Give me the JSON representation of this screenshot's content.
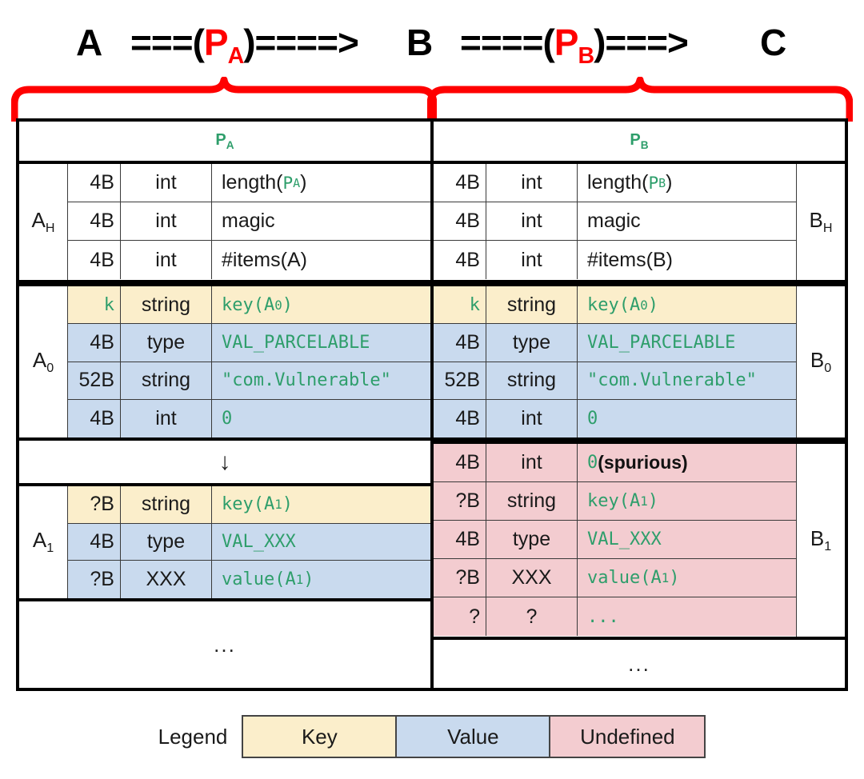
{
  "flow": {
    "node_a": "A",
    "arrow_a_pre": "===(",
    "arrow_a_label": "P",
    "arrow_a_sub": "A",
    "arrow_a_post": ")====>",
    "node_b": "B",
    "arrow_b_pre": "====(",
    "arrow_b_label": "P",
    "arrow_b_sub": "B",
    "arrow_b_post": ")===>",
    "node_c": "C",
    "accent_color": "#ff0000"
  },
  "sections": {
    "a": {
      "title_label": "P",
      "title_sub": "A",
      "blocks": [
        {
          "label": "A",
          "label_sub": "H",
          "tint": "none",
          "rows": [
            {
              "size": "4B",
              "type": "int",
              "value": "length(P",
              "value_sub": "A",
              "value_tail": ")",
              "value_mono_part": true
            },
            {
              "size": "4B",
              "type": "int",
              "value": "magic"
            },
            {
              "size": "4B",
              "type": "int",
              "value": "#items(A)"
            }
          ]
        },
        {
          "label": "A",
          "label_sub": "0",
          "rows": [
            {
              "size": "k",
              "size_mono": true,
              "type": "string",
              "value": "key(A",
              "value_sub": "0",
              "value_tail": ")",
              "tint": "key"
            },
            {
              "size": "4B",
              "type": "type",
              "value": "VAL_PARCELABLE",
              "tint": "value"
            },
            {
              "size": "52B",
              "type": "string",
              "value": "\"com.Vulnerable\"",
              "tint": "value"
            },
            {
              "size": "4B",
              "type": "int",
              "value": "0",
              "tint": "value"
            }
          ]
        },
        {
          "label": "A",
          "label_sub": "1",
          "rows": [
            {
              "size": "?B",
              "type": "string",
              "value": "key(A",
              "value_sub": "1",
              "value_tail": ")",
              "tint": "key"
            },
            {
              "size": "4B",
              "type": "type",
              "value": "VAL_XXX",
              "tint": "value"
            },
            {
              "size": "?B",
              "type": "XXX",
              "value": "value(A",
              "value_sub": "1",
              "value_tail": ")",
              "tint": "value"
            }
          ]
        }
      ],
      "gap_arrow": "↓",
      "tail_dots": "..."
    },
    "b": {
      "title_label": "P",
      "title_sub": "B",
      "blocks": [
        {
          "label": "B",
          "label_sub": "H",
          "tint": "none",
          "rows": [
            {
              "size": "4B",
              "type": "int",
              "value": "length(P",
              "value_sub": "B",
              "value_tail": ")"
            },
            {
              "size": "4B",
              "type": "int",
              "value": "magic"
            },
            {
              "size": "4B",
              "type": "int",
              "value": "#items(B)"
            }
          ]
        },
        {
          "label": "B",
          "label_sub": "0",
          "rows": [
            {
              "size": "k",
              "size_mono": true,
              "type": "string",
              "value": "key(A",
              "value_sub": "0",
              "value_tail": ")",
              "tint": "key"
            },
            {
              "size": "4B",
              "type": "type",
              "value": "VAL_PARCELABLE",
              "tint": "value"
            },
            {
              "size": "52B",
              "type": "string",
              "value": "\"com.Vulnerable\"",
              "tint": "value"
            },
            {
              "size": "4B",
              "type": "int",
              "value": "0",
              "tint": "value"
            }
          ]
        },
        {
          "label": "B",
          "label_sub": "1",
          "rows": [
            {
              "size": "4B",
              "type": "int",
              "value": "0",
              "value_note": " (spurious)",
              "tint": "undefined"
            },
            {
              "size": "?B",
              "type": "string",
              "value": "key(A",
              "value_sub": "1",
              "value_tail": ")",
              "tint": "undefined"
            },
            {
              "size": "4B",
              "type": "type",
              "value": "VAL_XXX",
              "tint": "undefined"
            },
            {
              "size": "?B",
              "type": "XXX",
              "value": "value(A",
              "value_sub": "1",
              "value_tail": ")",
              "tint": "undefined"
            },
            {
              "size": "?",
              "type": "?",
              "value": "...",
              "tint": "undefined"
            }
          ]
        }
      ],
      "tail_dots": "..."
    }
  },
  "legend": {
    "label": "Legend",
    "items": [
      {
        "name": "Key",
        "color": "#fbeecb"
      },
      {
        "name": "Value",
        "color": "#c9daee"
      },
      {
        "name": "Undefined",
        "color": "#f3ccd0"
      }
    ]
  },
  "colors": {
    "key": "#fbeecb",
    "value": "#c9daee",
    "undefined": "#f3ccd0",
    "mono_text": "#2e9e6b",
    "brace": "#ff0000",
    "border": "#000000"
  }
}
